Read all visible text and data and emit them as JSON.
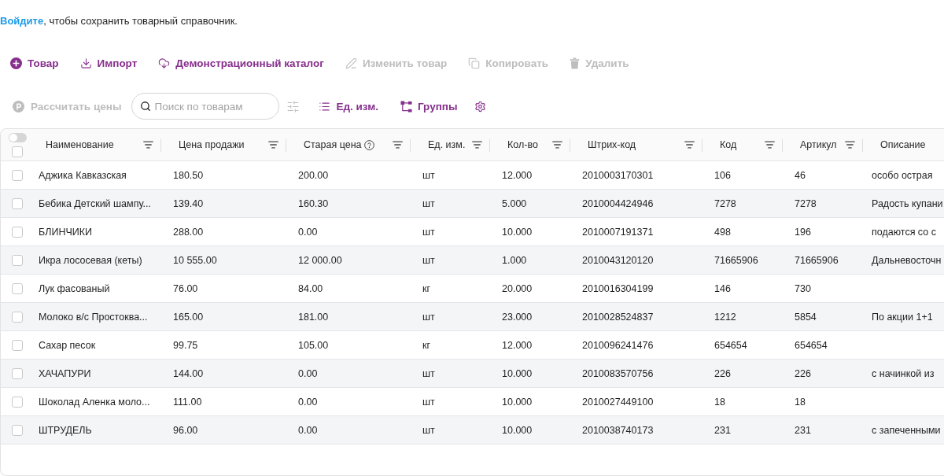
{
  "login_prompt": {
    "link": "Войдите",
    "text": ", чтобы сохранить товарный справочник."
  },
  "toolbar": {
    "buttons": [
      {
        "label": "Товар",
        "disabled": false
      },
      {
        "label": "Импорт",
        "disabled": false
      },
      {
        "label": "Демонстрационный каталог",
        "disabled": false
      },
      {
        "label": "Изменить товар",
        "disabled": true
      },
      {
        "label": "Копировать",
        "disabled": true
      },
      {
        "label": "Удалить",
        "disabled": true
      }
    ]
  },
  "toolbar_2": {
    "calculate_button": {
      "label": "Рассчитать цены",
      "disabled": true
    },
    "search": {
      "placeholder": "Поиск по товарам"
    },
    "filter_settings": {
      "disabled": true
    },
    "buttons": [
      {
        "label": "Ед. изм.",
        "disabled": false
      },
      {
        "label": "Группы",
        "disabled": false
      }
    ]
  },
  "table": {
    "select_toggle": {
      "on": false
    },
    "select_all": {
      "checked": false
    },
    "columns": [
      {
        "label": "Наименование",
        "filter": true
      },
      {
        "label": "Цена продажи",
        "filter": true
      },
      {
        "label": "Старая цена",
        "help": true,
        "filter": true
      },
      {
        "label": "Ед. изм.",
        "filter": true
      },
      {
        "label": "Кол-во",
        "filter": true
      },
      {
        "label": "Штрих-код",
        "filter": true
      },
      {
        "label": "Код",
        "filter": true
      },
      {
        "label": "Артикул",
        "filter": true
      },
      {
        "label": "Описание",
        "filter": false
      }
    ],
    "rows": [
      {
        "checked": false,
        "cells": [
          "Аджика Кавказская",
          "180.50",
          "200.00",
          "шт",
          "12.000",
          "2010003170301",
          "106",
          "46",
          "особо острая"
        ]
      },
      {
        "checked": false,
        "cells": [
          "Бебика Детский шампу...",
          "139.40",
          "160.30",
          "шт",
          "5.000",
          "2010004424946",
          "7278",
          "7278",
          "Радость купани"
        ]
      },
      {
        "checked": false,
        "cells": [
          "БЛИНЧИКИ",
          "288.00",
          "0.00",
          "шт",
          "10.000",
          "2010007191371",
          "498",
          "196",
          "подаются со с"
        ]
      },
      {
        "checked": false,
        "cells": [
          "Икра лососевая (кеты)",
          "10 555.00",
          "12 000.00",
          "шт",
          "1.000",
          "2010043120120",
          "71665906",
          "71665906",
          "Дальневосточн"
        ]
      },
      {
        "checked": false,
        "cells": [
          "Лук фасованый",
          "76.00",
          "84.00",
          "кг",
          "20.000",
          "2010016304199",
          "146",
          "730"
        ]
      },
      {
        "checked": false,
        "cells": [
          "Молоко в/с Простоква...",
          "165.00",
          "181.00",
          "шт",
          "23.000",
          "2010028524837",
          "1212",
          "5854",
          "По акции 1+1"
        ]
      },
      {
        "checked": false,
        "cells": [
          "Сахар песок",
          "99.75",
          "105.00",
          "кг",
          "12.000",
          "2010096241476",
          "654654",
          "654654"
        ]
      },
      {
        "checked": false,
        "cells": [
          "ХАЧАПУРИ",
          "144.00",
          "0.00",
          "шт",
          "10.000",
          "2010083570756",
          "226",
          "226",
          "с начинкой из"
        ]
      },
      {
        "checked": false,
        "cells": [
          "Шоколад Аленка моло...",
          "111.00",
          "0.00",
          "шт",
          "10.000",
          "2010027449100",
          "18",
          "18"
        ]
      },
      {
        "checked": false,
        "cells": [
          "ШТРУДЕЛЬ",
          "96.00",
          "0.00",
          "шт",
          "10.000",
          "2010038740173",
          "231",
          "231",
          "с запеченными"
        ]
      }
    ]
  }
}
